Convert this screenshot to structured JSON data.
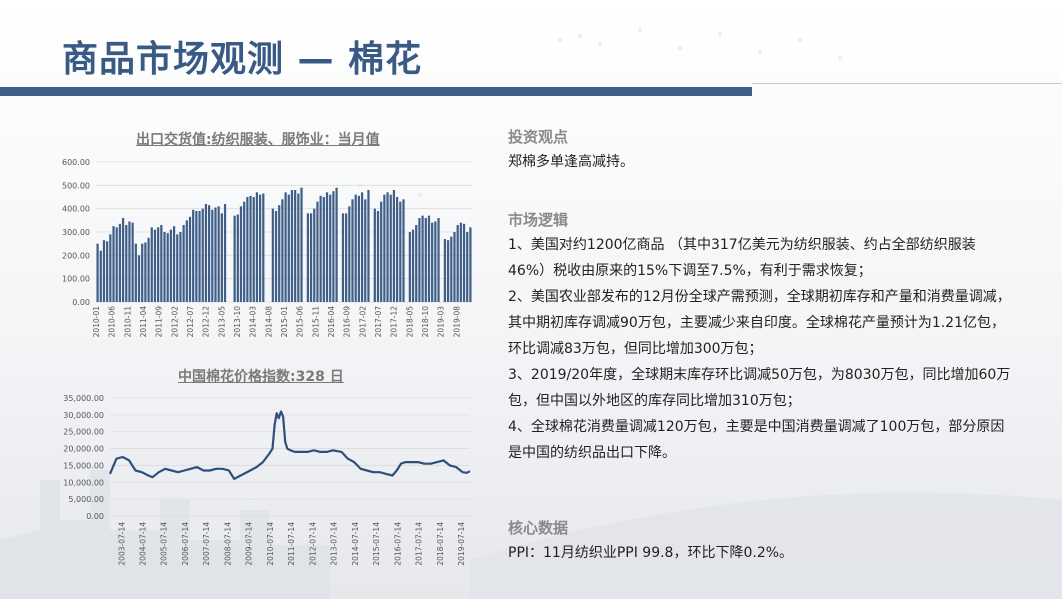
{
  "title": "商品市场观测 — 棉花",
  "colors": {
    "accent": "#3e5f8a",
    "title": "#3a5a86",
    "bar": "#3f5f88",
    "line": "#2f4f7a"
  },
  "sections": {
    "view": {
      "heading": "投资观点",
      "text": "郑棉多单逢高减持。"
    },
    "logic": {
      "heading": "市场逻辑",
      "items": [
        "1、美国对约1200亿商品 （其中317亿美元为纺织服装、约占全部纺织服装46%）税收由原来的15%下调至7.5%，有利于需求恢复；",
        "2、美国农业部发布的12月份全球产需预测，全球期初库存和产量和消费量调减，其中期初库存调减90万包，主要减少来自印度。全球棉花产量预计为1.21亿包，环比调减83万包，但同比增加300万包；",
        "3、2019/20年度，全球期末库存环比调减50万包，为8030万包，同比增加60万包，但中国以外地区的库存同比增加310万包；",
        "4、全球棉花消费量调减120万包，主要是中国消费量调减了100万包，部分原因是中国的纺织品出口下降。"
      ]
    },
    "core": {
      "heading": "核心数据",
      "text": "PPI：11月纺织业PPI 99.8，环比下降0.2%。"
    }
  },
  "chart_data": [
    {
      "type": "bar",
      "title": "出口交货值:纺织服装、服饰业：当月值",
      "ylim": [
        0,
        600
      ],
      "yticks": [
        "600.00",
        "500.00",
        "400.00",
        "300.00",
        "200.00",
        "100.00",
        "0.00"
      ],
      "ytick_values": [
        600,
        500,
        400,
        300,
        200,
        100,
        0
      ],
      "grid": true,
      "legend": "none",
      "xtick_labels": [
        "2010-01",
        "2010-06",
        "2010-11",
        "2011-04",
        "2011-09",
        "2012-02",
        "2012-07",
        "2012-12",
        "2013-05",
        "2013-10",
        "2014-03",
        "2014-08",
        "2015-01",
        "2015-06",
        "2015-11",
        "2016-04",
        "2016-09",
        "2017-02",
        "2017-07",
        "2017-12",
        "2018-05",
        "2018-10",
        "2019-03",
        "2019-08"
      ],
      "values": [
        250,
        220,
        265,
        260,
        290,
        325,
        320,
        335,
        360,
        330,
        345,
        340,
        250,
        200,
        250,
        255,
        275,
        320,
        310,
        320,
        330,
        300,
        295,
        310,
        325,
        290,
        300,
        330,
        350,
        365,
        395,
        390,
        390,
        400,
        420,
        415,
        395,
        405,
        410,
        380,
        420,
        0,
        0,
        370,
        375,
        410,
        430,
        450,
        455,
        450,
        470,
        460,
        465,
        0,
        0,
        400,
        390,
        415,
        440,
        470,
        460,
        480,
        480,
        465,
        490,
        0,
        380,
        380,
        400,
        430,
        455,
        450,
        470,
        460,
        475,
        490,
        0,
        380,
        380,
        410,
        440,
        460,
        455,
        470,
        440,
        480,
        0,
        400,
        390,
        430,
        460,
        470,
        460,
        480,
        450,
        430,
        440,
        0,
        300,
        310,
        330,
        360,
        370,
        360,
        370,
        340,
        345,
        360,
        0,
        270,
        265,
        280,
        300,
        330,
        340,
        335,
        300,
        320
      ]
    },
    {
      "type": "line",
      "title": "中国棉花价格指数:328 日",
      "ylim": [
        0,
        35000
      ],
      "yticks": [
        "35,000.00",
        "30,000.00",
        "25,000.00",
        "20,000.00",
        "15,000.00",
        "10,000.00",
        "5,000.00",
        "0.00"
      ],
      "ytick_values": [
        35000,
        30000,
        25000,
        20000,
        15000,
        10000,
        5000,
        0
      ],
      "grid": true,
      "legend": "none",
      "xtick_labels": [
        "2003-07-14",
        "2004-07-14",
        "2005-07-14",
        "2006-07-14",
        "2007-07-14",
        "2008-07-14",
        "2009-07-14",
        "2010-07-14",
        "2011-07-14",
        "2012-07-14",
        "2013-07-14",
        "2014-07-14",
        "2015-07-14",
        "2016-07-14",
        "2017-07-14",
        "2018-07-14",
        "2019-07-14"
      ],
      "x_start": 2003.0,
      "x_end": 2019.95,
      "series": [
        {
          "x": [
            2003.0,
            2003.3,
            2003.6,
            2003.9,
            2004.2,
            2004.5,
            2004.8,
            2005.0,
            2005.3,
            2005.6,
            2005.9,
            2006.2,
            2006.5,
            2006.8,
            2007.1,
            2007.4,
            2007.7,
            2008.0,
            2008.3,
            2008.6,
            2008.85,
            2009.0,
            2009.3,
            2009.6,
            2009.9,
            2010.2,
            2010.5,
            2010.65,
            2010.75,
            2010.85,
            2010.95,
            2011.05,
            2011.15,
            2011.25,
            2011.35,
            2011.5,
            2011.7,
            2012.0,
            2012.3,
            2012.6,
            2012.9,
            2013.2,
            2013.5,
            2013.9,
            2014.2,
            2014.5,
            2014.8,
            2015.1,
            2015.4,
            2015.7,
            2016.0,
            2016.3,
            2016.5,
            2016.7,
            2016.9,
            2017.2,
            2017.5,
            2017.8,
            2018.1,
            2018.4,
            2018.7,
            2019.0,
            2019.3,
            2019.6,
            2019.8,
            2019.95
          ],
          "y": [
            12500,
            17000,
            17500,
            16500,
            13500,
            13000,
            12000,
            11500,
            13000,
            14000,
            13500,
            13000,
            13500,
            14000,
            14500,
            13500,
            13500,
            14000,
            14000,
            13500,
            11000,
            11500,
            12500,
            13500,
            14500,
            16000,
            18500,
            20000,
            27000,
            30500,
            29000,
            31000,
            29500,
            22000,
            20000,
            19500,
            19000,
            19000,
            19000,
            19500,
            19000,
            19000,
            19500,
            19000,
            17000,
            16000,
            14000,
            13500,
            13000,
            13000,
            12500,
            12000,
            13500,
            15500,
            16000,
            16000,
            16000,
            15500,
            15500,
            16000,
            16500,
            15000,
            14500,
            13000,
            12800,
            13300
          ]
        }
      ]
    }
  ]
}
